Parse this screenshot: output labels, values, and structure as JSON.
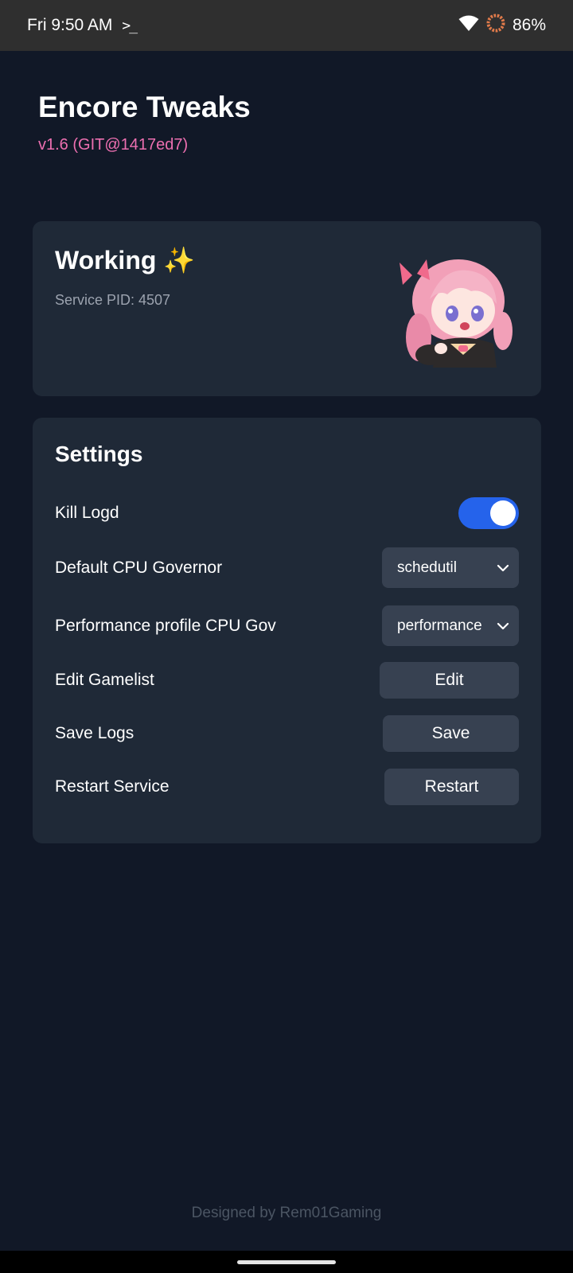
{
  "status_bar": {
    "time": "Fri 9:50 AM",
    "battery": "86%",
    "icons": [
      "terminal-icon",
      "wifi-icon",
      "battery-ring-icon"
    ]
  },
  "header": {
    "title": "Encore Tweaks",
    "version": "v1.6 (GIT@1417ed7)"
  },
  "status_card": {
    "title": "Working ✨",
    "pid_text": "Service PID: 4507"
  },
  "settings": {
    "title": "Settings",
    "kill_logd": {
      "label": "Kill Logd",
      "enabled": true
    },
    "default_governor": {
      "label": "Default CPU Governor",
      "value": "schedutil"
    },
    "performance_governor": {
      "label": "Performance profile CPU Gov",
      "value": "performance"
    },
    "edit_gamelist": {
      "label": "Edit Gamelist",
      "button": "Edit"
    },
    "save_logs": {
      "label": "Save Logs",
      "button": "Save"
    },
    "restart_service": {
      "label": "Restart Service",
      "button": "Restart"
    }
  },
  "footer": {
    "credit": "Designed by Rem01Gaming"
  },
  "colors": {
    "background": "#111827",
    "card": "#1f2937",
    "control": "#374151",
    "accent": "#2563eb",
    "version": "#ec6fb0",
    "muted": "#9ca3af",
    "footer": "#4b5563"
  }
}
